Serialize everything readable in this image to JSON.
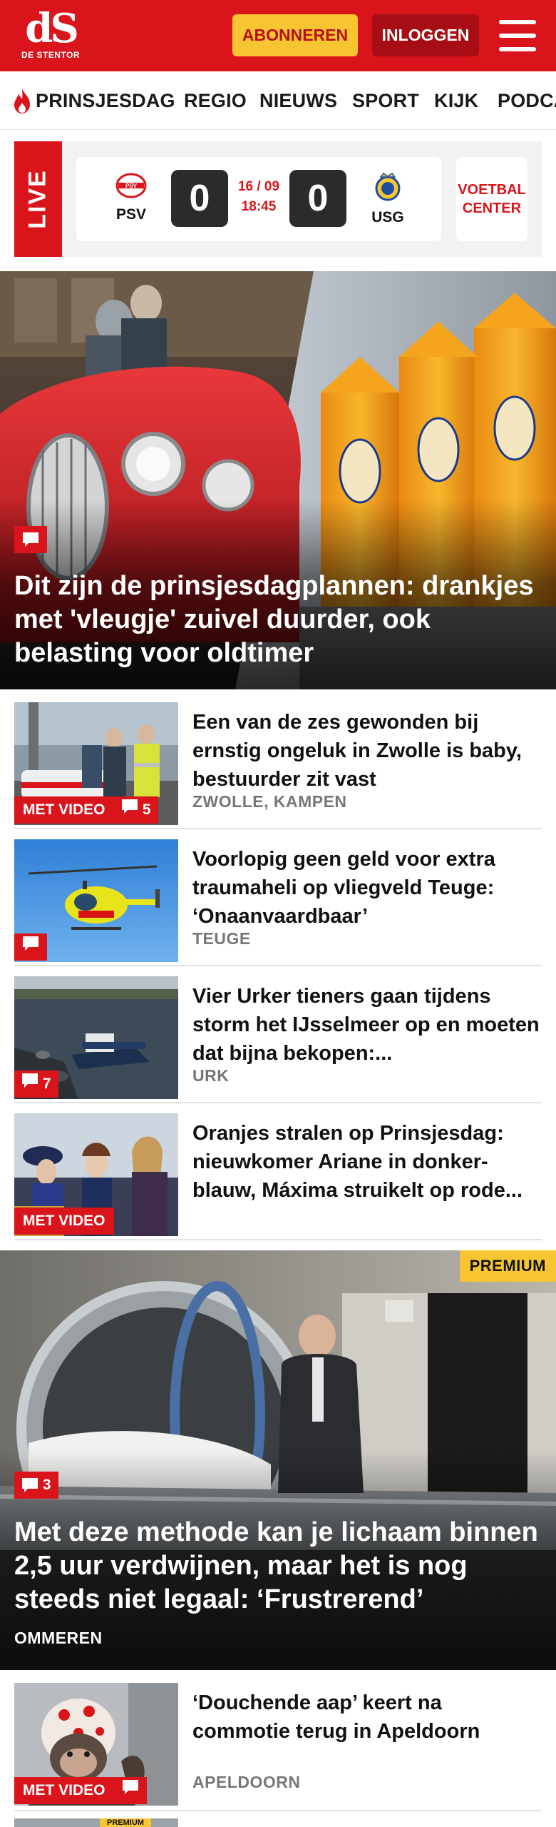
{
  "header": {
    "logo_mark": "dS",
    "logo_sub": "DE STENTOR",
    "subscribe_label": "ABONNEREN",
    "login_label": "INLOGGEN",
    "brand_color": "#d9141b"
  },
  "nav": {
    "items": [
      "PRINSJESDAG",
      "REGIO",
      "NIEUWS",
      "SPORT",
      "KIJK",
      "PODCA"
    ]
  },
  "live": {
    "label": "LIVE",
    "home_team": "PSV",
    "away_team": "USG",
    "home_score": "0",
    "away_score": "0",
    "date": "16 / 09",
    "time": "18:45",
    "center_line1": "VOETBAL",
    "center_line2": "CENTER"
  },
  "hero": {
    "title": "Dit zijn de prinsjesdagplannen: drankjes met 'vleugje' zuivel duurder, ook belasting voor oldtimer",
    "comment_icon": "comment-icon"
  },
  "articles": [
    {
      "title": "Een van de zes gewonden bij ernstig ongeluk in Zwolle is baby, bestuurder zit vast",
      "location": "ZWOLLE, KAMPEN",
      "video_label": "MET VIDEO",
      "comments": "5"
    },
    {
      "title": "Voorlopig geen geld voor extra traumaheli op vliegveld Teuge: ‘Onaanvaardbaar’",
      "location": "TEUGE"
    },
    {
      "title": "Vier Urker tieners gaan tijdens storm het IJsselmeer op en moeten dat bijna bekopen:...",
      "location": "URK",
      "comments": "7"
    },
    {
      "title": "Oranjes stralen op Prinsjesdag: nieuwkomer Ariane in donker-blauw, Máxima struikelt op rode...",
      "video_label": "MET VIDEO"
    }
  ],
  "hero2": {
    "premium_label": "PREMIUM",
    "comments": "3",
    "title": "Met deze methode kan je lichaam binnen 2,5 uur verdwijnen, maar het is nog steeds niet legaal: ‘Frustrerend’",
    "location": "OMMEREN"
  },
  "article5": {
    "title": "‘Douchende aap’ keert na commotie terug in Apeldoorn",
    "location": "APELDOORN",
    "video_label": "MET VIDEO",
    "premium_label": "PREMIUM"
  }
}
